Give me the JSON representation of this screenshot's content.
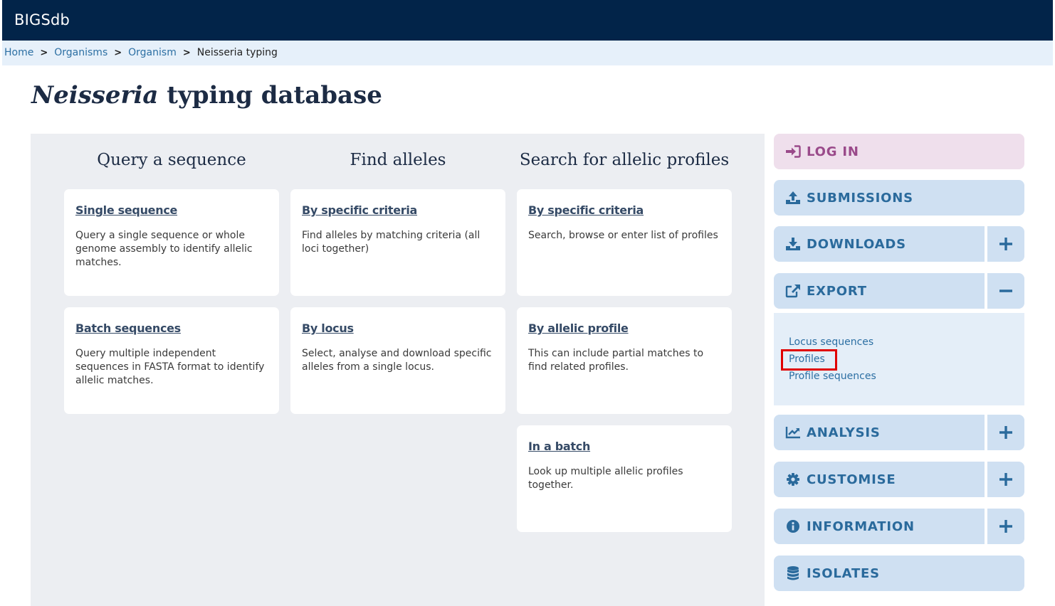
{
  "app": {
    "brand": "BIGSdb"
  },
  "breadcrumb": {
    "items": [
      "Home",
      "Organisms",
      "Organism"
    ],
    "current": "Neisseria typing",
    "separator": ">"
  },
  "page": {
    "title_italic": "Neisseria",
    "title_rest": " typing database"
  },
  "columns": [
    {
      "heading": "Query a sequence"
    },
    {
      "heading": "Find alleles"
    },
    {
      "heading": "Search for allelic profiles"
    }
  ],
  "cards": {
    "single_sequence": {
      "title": "Single sequence",
      "desc": "Query a single sequence or whole genome assembly to identify allelic matches."
    },
    "batch_sequences": {
      "title": "Batch sequences",
      "desc": "Query multiple independent sequences in FASTA format to identify allelic matches."
    },
    "alleles_by_criteria": {
      "title": "By specific criteria",
      "desc": "Find alleles by matching criteria (all loci together)"
    },
    "by_locus": {
      "title": "By locus",
      "desc": "Select, analyse and download specific alleles from a single locus."
    },
    "profiles_by_criteria": {
      "title": "By specific criteria",
      "desc": "Search, browse or enter list of profiles"
    },
    "by_allelic_profile": {
      "title": "By allelic profile",
      "desc": "This can include partial matches to find related profiles."
    },
    "in_a_batch": {
      "title": "In a batch",
      "desc": "Look up multiple allelic profiles together."
    }
  },
  "sidebar": {
    "login": "LOG IN",
    "submissions": "SUBMISSIONS",
    "downloads": "DOWNLOADS",
    "export": "EXPORT",
    "export_links": [
      "Locus sequences",
      "Profiles",
      "Profile sequences"
    ],
    "analysis": "ANALYSIS",
    "customise": "CUSTOMISE",
    "information": "INFORMATION",
    "isolates": "ISOLATES"
  },
  "colors": {
    "topbar": "#022449",
    "accent": "#2a6a9c",
    "login": "#9a4a8a",
    "highlight": "#e00000"
  }
}
